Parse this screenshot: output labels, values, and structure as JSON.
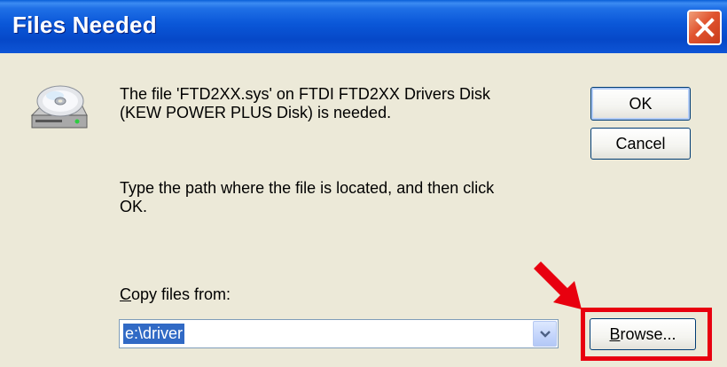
{
  "window": {
    "title": "Files Needed",
    "close_icon": "close-icon"
  },
  "message": {
    "line1": "The file 'FTD2XX.sys' on FTDI FTD2XX Drivers Disk",
    "line2": "(KEW POWER PLUS Disk) is needed.",
    "instruction_line1": "Type the path where the file is located, and then click",
    "instruction_line2": "OK."
  },
  "buttons": {
    "ok_label": "OK",
    "cancel_label": "Cancel",
    "browse_label_underlined": "B",
    "browse_label_rest": "rowse..."
  },
  "copy_from": {
    "label_underlined": "C",
    "label_rest": "opy files from:",
    "value": "e:\\driver"
  },
  "annotation": {
    "highlight_color": "#E8000F",
    "icon": "red-arrow-icon"
  },
  "colors": {
    "title_bar": "#0A57D8",
    "dialog_bg": "#ECE9D8",
    "selection": "#316AC5"
  }
}
